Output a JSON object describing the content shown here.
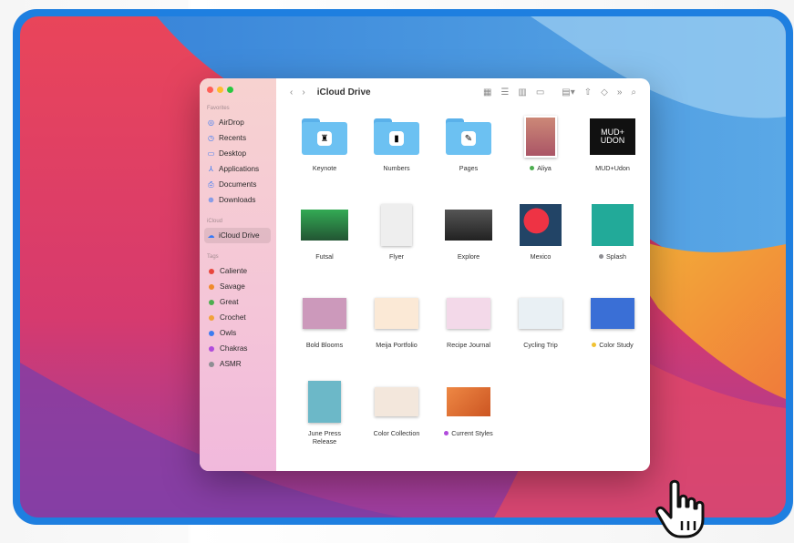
{
  "colors": {
    "frame": "#1e7fe0",
    "finder_accent": "#3478f6",
    "folder": "#6cc1f2"
  },
  "window": {
    "title": "iCloud Drive",
    "toolbar_icons": [
      "back-icon",
      "forward-icon",
      "icon-view-icon",
      "list-view-icon",
      "column-view-icon",
      "gallery-view-icon",
      "group-icon",
      "share-icon",
      "tag-icon",
      "more-icon",
      "search-icon"
    ]
  },
  "sidebar": {
    "favorites_title": "Favorites",
    "favorites": [
      {
        "label": "AirDrop",
        "icon": "airdrop-icon"
      },
      {
        "label": "Recents",
        "icon": "clock-icon"
      },
      {
        "label": "Desktop",
        "icon": "desktop-icon"
      },
      {
        "label": "Applications",
        "icon": "applications-icon"
      },
      {
        "label": "Documents",
        "icon": "document-icon"
      },
      {
        "label": "Downloads",
        "icon": "download-icon"
      }
    ],
    "icloud_title": "iCloud",
    "icloud": [
      {
        "label": "iCloud Drive",
        "icon": "cloud-icon"
      }
    ],
    "tags_title": "Tags",
    "tags": [
      {
        "label": "Caliente",
        "color": "#e8453c"
      },
      {
        "label": "Savage",
        "color": "#f08a2c"
      },
      {
        "label": "Great",
        "color": "#4cae4f"
      },
      {
        "label": "Crochet",
        "color": "#f1a23a"
      },
      {
        "label": "Owls",
        "color": "#3d7bf0"
      },
      {
        "label": "Chakras",
        "color": "#b04bdc"
      },
      {
        "label": "ASMR",
        "color": "#8e8e93"
      }
    ]
  },
  "files": [
    {
      "label": "Keynote",
      "kind": "folder",
      "icon": "keynote-icon"
    },
    {
      "label": "Numbers",
      "kind": "folder",
      "icon": "numbers-icon"
    },
    {
      "label": "Pages",
      "kind": "folder",
      "icon": "pages-icon"
    },
    {
      "label": "Aliya",
      "kind": "photo",
      "tag": "#4cae4f"
    },
    {
      "label": "MUD+Udon",
      "kind": "photo"
    },
    {
      "label": "Futsal",
      "kind": "video"
    },
    {
      "label": "Flyer",
      "kind": "doc"
    },
    {
      "label": "Explore",
      "kind": "video"
    },
    {
      "label": "Mexico",
      "kind": "photo"
    },
    {
      "label": "Splash",
      "kind": "photo",
      "tag": "#8e8e93"
    },
    {
      "label": "Bold Blooms",
      "kind": "slide"
    },
    {
      "label": "Meija Portfolio",
      "kind": "slide"
    },
    {
      "label": "Recipe Journal",
      "kind": "slide"
    },
    {
      "label": "Cycling Trip",
      "kind": "slide"
    },
    {
      "label": "Color Study",
      "kind": "slide",
      "tag": "#f1c232"
    },
    {
      "label": "June Press Release",
      "kind": "doc"
    },
    {
      "label": "Color Collection",
      "kind": "slide"
    },
    {
      "label": "Current Styles",
      "kind": "slide",
      "tag": "#b04bdc"
    }
  ],
  "mud_text": "MUD+ UDON"
}
